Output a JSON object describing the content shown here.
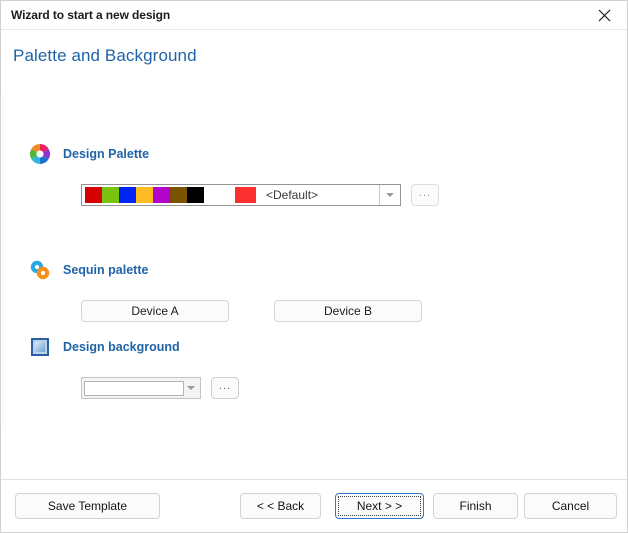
{
  "window": {
    "title": "Wizard to start a new design",
    "close_icon": "close-icon"
  },
  "page": {
    "heading": "Palette and Background"
  },
  "sections": {
    "design_palette": {
      "title": "Design Palette",
      "icon": "color-wheel-icon",
      "combo": {
        "value": "<Default>",
        "swatches": [
          "#d60000",
          "#7ac410",
          "#0026f5",
          "#ffbb22",
          "#b304cc",
          "#7a5200",
          "#000000"
        ],
        "selected_swatch": "#fc3030",
        "arrow_icon": "chevron-down-icon"
      },
      "browse_button": "..."
    },
    "sequin_palette": {
      "title": "Sequin palette",
      "icon": "sequin-icon",
      "device_a": "Device A",
      "device_b": "Device B"
    },
    "design_background": {
      "title": "Design background",
      "icon": "background-frame-icon",
      "combo": {
        "value": "",
        "arrow_icon": "chevron-down-icon"
      },
      "browse_button": "..."
    }
  },
  "footer": {
    "save_template": "Save Template",
    "back": "< < Back",
    "next": "Next > >",
    "finish": "Finish",
    "cancel": "Cancel"
  },
  "colors": {
    "accent": "#1f63a8",
    "focus_border": "#3079c8"
  }
}
